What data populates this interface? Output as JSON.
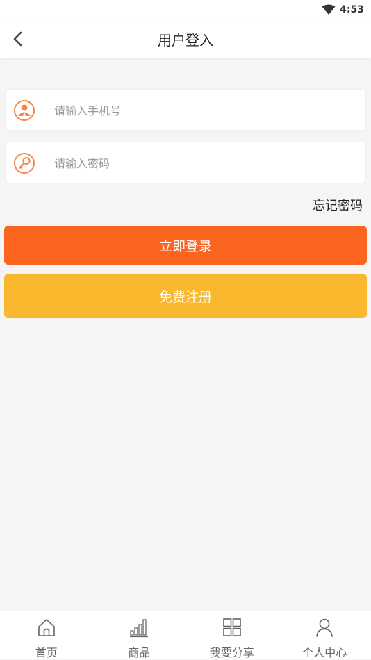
{
  "status": {
    "time": "4:53",
    "icon": "wifi-icon"
  },
  "header": {
    "title": "用户登入",
    "back_icon": "chevron-left-icon"
  },
  "form": {
    "phone": {
      "placeholder": "请输入手机号",
      "value": "",
      "icon": "user-icon"
    },
    "password": {
      "placeholder": "请输入密码",
      "value": "",
      "icon": "key-icon"
    },
    "forgot_label": "忘记密码",
    "login_label": "立即登录",
    "register_label": "免费注册"
  },
  "tabbar": {
    "items": [
      {
        "label": "首页",
        "icon": "home-icon"
      },
      {
        "label": "商品",
        "icon": "bar-chart-icon"
      },
      {
        "label": "我要分享",
        "icon": "grid-icon"
      },
      {
        "label": "个人中心",
        "icon": "person-icon"
      }
    ]
  },
  "colors": {
    "accent_orange": "#fb6520",
    "accent_yellow": "#f9b82d",
    "icon_orange": "#f7854a"
  }
}
